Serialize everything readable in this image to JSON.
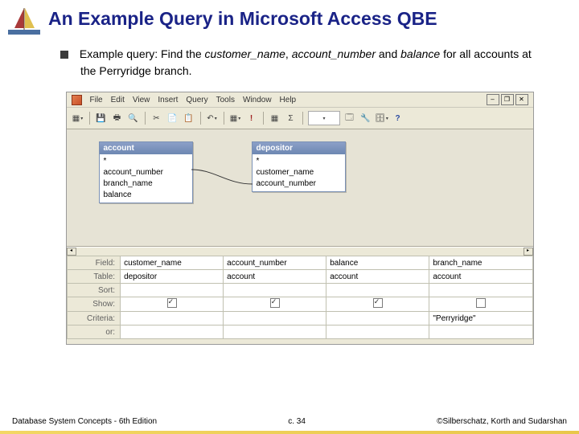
{
  "slide": {
    "title": "An Example Query in Microsoft Access QBE",
    "bullet": {
      "prefix": "Example query: Find the ",
      "em1": "customer_name",
      "mid1": ", ",
      "em2": "account_number",
      "mid2": " and ",
      "em3": "balance",
      "suffix": " for all accounts at the Perryridge branch."
    }
  },
  "menubar": [
    "File",
    "Edit",
    "View",
    "Insert",
    "Query",
    "Tools",
    "Window",
    "Help"
  ],
  "toolbar_icons": [
    "▦",
    "▾",
    "🖫",
    "🖶",
    "👁",
    "✂",
    "📋",
    "📋",
    "↶",
    "▾",
    "▦",
    "!",
    "▾",
    "Σ",
    "▾",
    "📄",
    "🔧",
    "▾",
    "?"
  ],
  "tables": {
    "account": {
      "title": "account",
      "fields": [
        "*",
        "account_number",
        "branch_name",
        "balance"
      ]
    },
    "depositor": {
      "title": "depositor",
      "fields": [
        "*",
        "customer_name",
        "account_number"
      ]
    }
  },
  "grid": {
    "rows": [
      "Field:",
      "Table:",
      "Sort:",
      "Show:",
      "Criteria:",
      "or:"
    ],
    "cols": [
      {
        "field": "customer_name",
        "table": "depositor",
        "show": true,
        "criteria": ""
      },
      {
        "field": "account_number",
        "table": "account",
        "show": true,
        "criteria": ""
      },
      {
        "field": "balance",
        "table": "account",
        "show": true,
        "criteria": ""
      },
      {
        "field": "branch_name",
        "table": "account",
        "show": false,
        "criteria": "\"Perryridge\""
      }
    ]
  },
  "footer": {
    "left": "Database System Concepts - 6th Edition",
    "center": "c. 34",
    "right": "©Silberschatz, Korth and Sudarshan"
  }
}
